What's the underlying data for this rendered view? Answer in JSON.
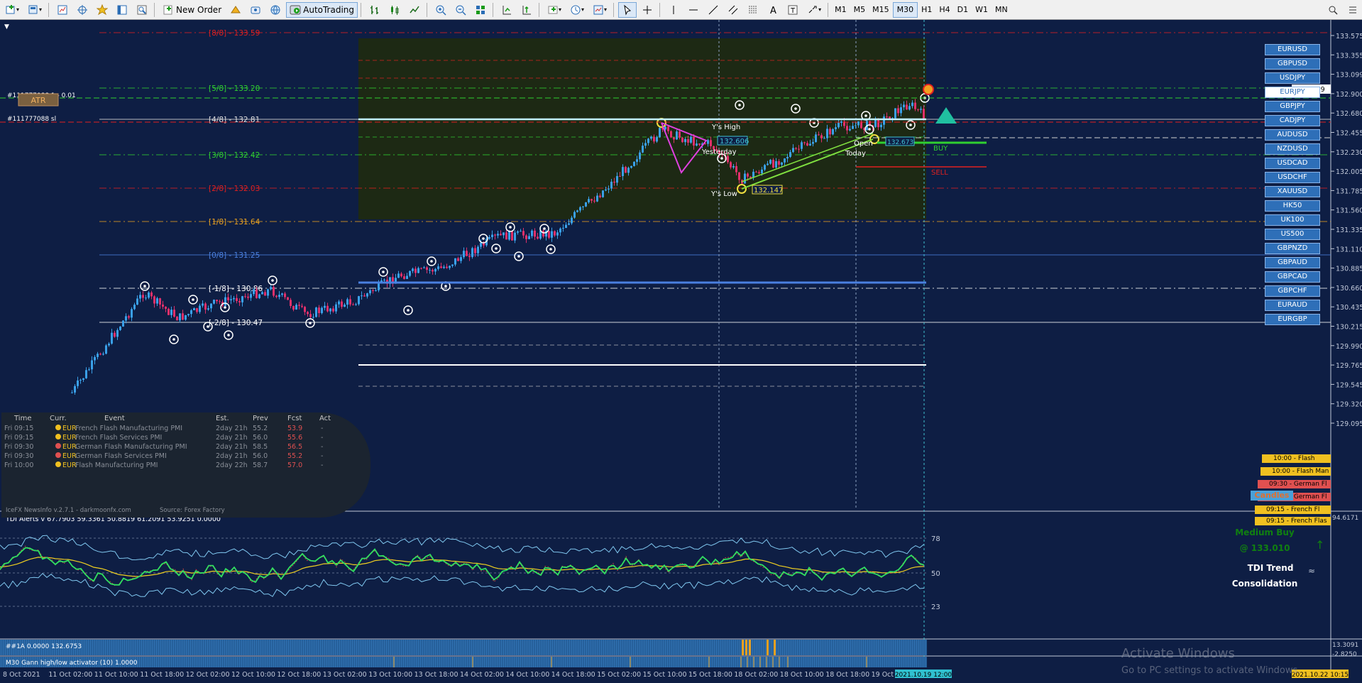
{
  "toolbar": {
    "new_order": "New Order",
    "autotrading": "AutoTrading",
    "timeframes": [
      "M1",
      "M5",
      "M15",
      "M30",
      "H1",
      "H4",
      "D1",
      "W1",
      "MN"
    ],
    "active_timeframe": "M30"
  },
  "chart": {
    "gann_levels": [
      {
        "label": "[8/8] - 133.59",
        "color": "#e02020"
      },
      {
        "label": "[5/8] - 133.20",
        "color": "#30d030"
      },
      {
        "label": "[4/8] - 132.81",
        "color": "#e0e0e0"
      },
      {
        "label": "[3/8] - 132.42",
        "color": "#30d030"
      },
      {
        "label": "[2/8] - 132.03",
        "color": "#e02020"
      },
      {
        "label": "[1/8] - 131.64",
        "color": "#e8a020"
      },
      {
        "label": "[0/8] - 131.25",
        "color": "#4a80e0"
      },
      {
        "label": "[-1/8] - 130.86",
        "color": "#ffffff"
      },
      {
        "label": "[-2/8] - 130.47",
        "color": "#ffffff"
      }
    ],
    "order_labels": [
      "#111777088 1 - 0.01",
      "#111777088 sl"
    ],
    "atr_label": "ATR",
    "ys_high": "Y's High",
    "ys_high_value": "132.606",
    "ys_low": "Y's Low",
    "ys_low_value": "132.147",
    "yesterday": "Yesterday",
    "open": "Open",
    "today": "Today",
    "open_value": "132.673",
    "buy": "BUY",
    "sell": "SELL",
    "price_axis": [
      "133.575",
      "133.355",
      "133.099",
      "132.900",
      "132.680",
      "132.455",
      "132.230",
      "132.005",
      "131.785",
      "131.560",
      "131.335",
      "131.110",
      "130.885",
      "130.660",
      "130.435",
      "130.215",
      "129.990",
      "129.765",
      "129.545",
      "129.320",
      "129.095"
    ],
    "current_price": "133.099",
    "time_axis": [
      "8 Oct 2021",
      "11 Oct 02:00",
      "11 Oct 10:00",
      "11 Oct 18:00",
      "12 Oct 02:00",
      "12 Oct 10:00",
      "12 Oct 18:00",
      "13 Oct 02:00",
      "13 Oct 10:00",
      "13 Oct 18:00",
      "14 Oct 02:00",
      "14 Oct 10:00",
      "14 Oct 18:00",
      "15 Oct 02:00",
      "15 Oct 10:00",
      "15 Oct 18:00",
      "18 Oct 02:00",
      "18 Oct 10:00",
      "18 Oct 18:00",
      "19 Oct 02:00"
    ],
    "time_highlight": "2021.10.19 12:00",
    "time_right": "2021.10.22 10:15"
  },
  "symbols": [
    "EURUSD",
    "GBPUSD",
    "USDJPY",
    "EURJPY",
    "GBPJPY",
    "CADJPY",
    "AUDUSD",
    "NZDUSD",
    "USDCAD",
    "USDCHF",
    "XAUUSD",
    "HK50",
    "UK100",
    "US500",
    "GBPNZD",
    "GBPAUD",
    "GBPCAD",
    "GBPCHF",
    "EURAUD",
    "EURGBP"
  ],
  "selected_symbol": "EURJPY",
  "news": {
    "headers": [
      "Time",
      "Curr.",
      "Event",
      "Est.",
      "Prev",
      "Fcst",
      "Act"
    ],
    "rows": [
      {
        "day": "Fri",
        "time": "09:15",
        "curr": "EUR",
        "event": "French Flash Manufacturing PMI",
        "est": "2day 21h",
        "prev": "55.2",
        "fcst": "53.9",
        "act": "-",
        "impact": "med"
      },
      {
        "day": "Fri",
        "time": "09:15",
        "curr": "EUR",
        "event": "French Flash Services PMI",
        "est": "2day 21h",
        "prev": "56.0",
        "fcst": "55.6",
        "act": "-",
        "impact": "med"
      },
      {
        "day": "Fri",
        "time": "09:30",
        "curr": "EUR",
        "event": "German Flash Manufacturing PMI",
        "est": "2day 21h",
        "prev": "58.5",
        "fcst": "56.5",
        "act": "-",
        "impact": "high"
      },
      {
        "day": "Fri",
        "time": "09:30",
        "curr": "EUR",
        "event": "German Flash Services PMI",
        "est": "2day 21h",
        "prev": "56.0",
        "fcst": "55.2",
        "act": "-",
        "impact": "high"
      },
      {
        "day": "Fri",
        "time": "10:00",
        "curr": "EUR",
        "event": "Flash Manufacturing PMI",
        "est": "2day 22h",
        "prev": "58.7",
        "fcst": "57.0",
        "act": "-",
        "impact": "med"
      }
    ],
    "footer_left": "IceFX NewsInfo v.2.7.1  -  darkmoonfx.com",
    "footer_right": "Source: Forex Factory"
  },
  "news_bar": [
    {
      "text": "10:00 - Flash",
      "color": "#f0c020"
    },
    {
      "text": "10:00 - Flash Man",
      "color": "#f0c020"
    },
    {
      "text": "09:30 - German Fl",
      "color": "#e05050"
    },
    {
      "text": "09:30 - German Fl",
      "color": "#e05050"
    },
    {
      "text": "09:15 - French Fl",
      "color": "#f0c020"
    },
    {
      "text": "09:15 - French Flas",
      "color": "#f0c020"
    }
  ],
  "candles_label": "Candles",
  "tdi": {
    "title": "TDI Alerts v 67.7903 59.3361 50.8819 61.2091 53.9251 0.0000",
    "levels": [
      "78",
      "50",
      "23"
    ],
    "signal": "Medium Buy",
    "signal_price": "@ 133.010",
    "trend_label": "TDI Trend",
    "trend_value": "Consolidation",
    "axis_top": "94.6171"
  },
  "indicator1": {
    "title": "##1A 0.0000 132.6753",
    "axis": "13.3091"
  },
  "indicator2": {
    "title": "M30 Gann high/low activator (10) 1.0000",
    "axis": "-2.8250"
  },
  "watermark": {
    "line1": "Activate Windows",
    "line2": "Go to PC settings to activate Windows."
  }
}
